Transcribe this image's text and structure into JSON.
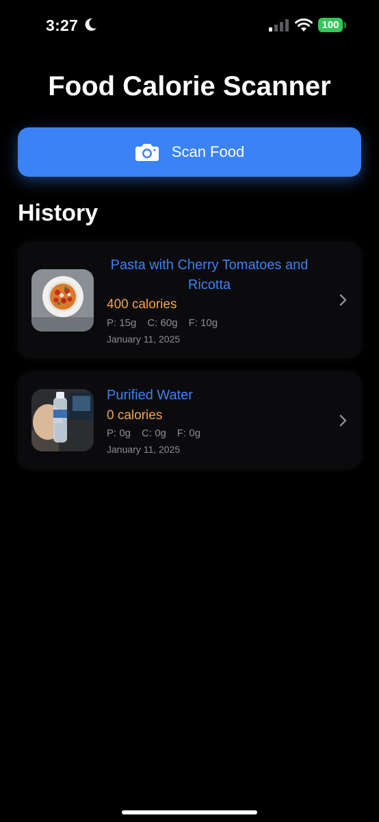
{
  "status_bar": {
    "time": "3:27",
    "battery": "100",
    "icons": [
      "moon-icon",
      "signal-icon",
      "wifi-icon",
      "battery-icon"
    ]
  },
  "app": {
    "title": "Food Calorie Scanner"
  },
  "scan_button": {
    "label": "Scan Food",
    "icon": "camera-icon",
    "color": "#3b82f6"
  },
  "history": {
    "heading": "History",
    "items": [
      {
        "name": "Pasta with Cherry Tomatoes and Ricotta",
        "calories": "400 calories",
        "protein": "P: 15g",
        "carbs": "C: 60g",
        "fat": "F: 10g",
        "date": "January 11, 2025",
        "thumbnail": "pasta-photo"
      },
      {
        "name": "Purified Water",
        "calories": "0 calories",
        "protein": "P: 0g",
        "carbs": "C: 0g",
        "fat": "F: 0g",
        "date": "January 11, 2025",
        "thumbnail": "water-bottle-photo"
      }
    ]
  },
  "colors": {
    "accent": "#3b82f6",
    "calories": "#f4a450",
    "secondary_text": "#8e8e93",
    "battery": "#34c759"
  }
}
